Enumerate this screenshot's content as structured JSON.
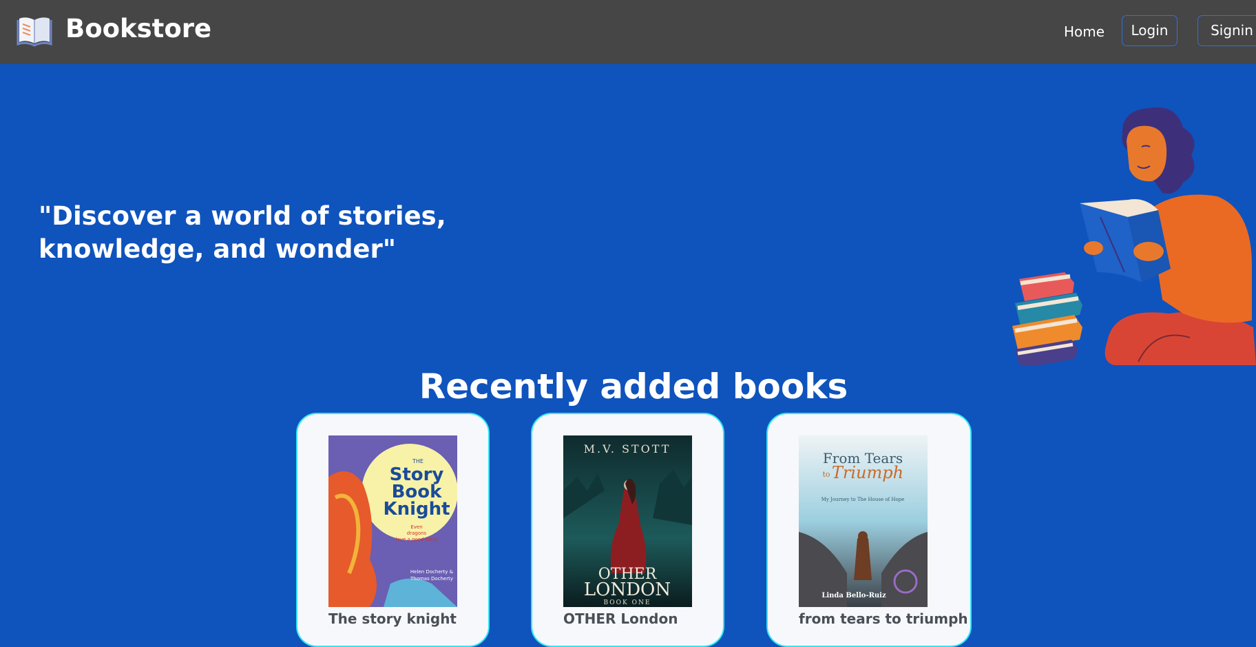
{
  "header": {
    "brand": "Bookstore",
    "logo_icon": "open-book-icon",
    "nav": {
      "home": "Home",
      "login": "Login",
      "signin": "Signin"
    }
  },
  "hero": {
    "quote": "\"Discover a world of stories, knowledge, and wonder\"",
    "illustration": "reading-person-illustration"
  },
  "section": {
    "title": "Recently added books"
  },
  "books": [
    {
      "name": "The story knight",
      "cover": {
        "title_lines": [
          "THE",
          "Story",
          "Book",
          "Knight"
        ],
        "tagline_lines": [
          "Even",
          "dragons",
          "love a good story"
        ],
        "author_lines": [
          "Helen Docherty &",
          "Thomas Docherty"
        ]
      }
    },
    {
      "name": "OTHER London",
      "cover": {
        "author": "M.V. STOTT",
        "title_lines": [
          "OTHER",
          "LONDON"
        ],
        "subtitle": "BOOK ONE"
      }
    },
    {
      "name": "from tears to triumph",
      "cover": {
        "title_lines": [
          "From Tears",
          "to",
          "Triumph"
        ],
        "subtitle": "My Journey to The House of Hope",
        "author": "Linda Bello-Ruiz"
      }
    }
  ],
  "colors": {
    "navbar": "#464646",
    "page_background": "#0f53bd",
    "card_border": "#2ee6f5",
    "card_background": "#f6f8fb"
  }
}
